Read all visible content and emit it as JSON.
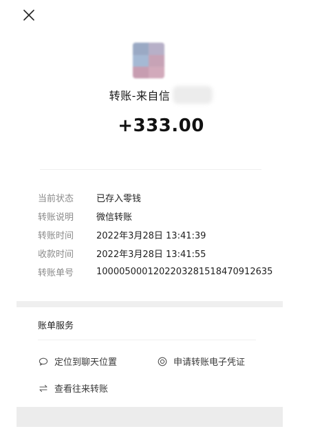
{
  "header": {
    "close_icon": "close-icon"
  },
  "avatar": {
    "colors": [
      "#9aa9c4",
      "#c7a3b6",
      "#b7b0c8",
      "#c79db1",
      "#a5b9d4",
      "#d2aabb"
    ]
  },
  "transfer": {
    "title": "转账-来自信",
    "amount": "+333.00"
  },
  "details": [
    {
      "label": "当前状态",
      "value": "已存入零钱"
    },
    {
      "label": "转账说明",
      "value": "微信转账"
    },
    {
      "label": "转账时间",
      "value": "2022年3月28日 13:41:39"
    },
    {
      "label": "收款时间",
      "value": "2022年3月28日 13:41:55"
    },
    {
      "label": "转账单号",
      "value": "1000050001202203281518470912635"
    }
  ],
  "services": {
    "title": "账单服务",
    "items": [
      {
        "label": "定位到聊天位置",
        "icon": "chat-bubble-icon"
      },
      {
        "label": "申请转账电子凭证",
        "icon": "certificate-icon"
      },
      {
        "label": "查看往来转账",
        "icon": "transfer-arrows-icon"
      }
    ]
  }
}
